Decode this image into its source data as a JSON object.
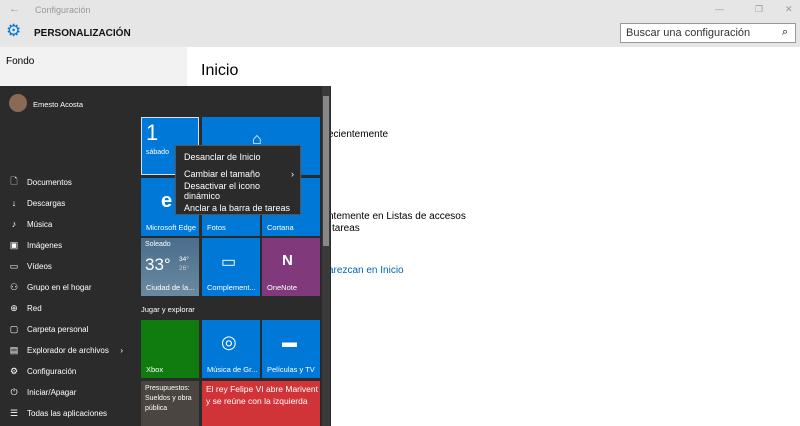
{
  "window": {
    "title": "Configuración",
    "back_icon": "←",
    "min": "—",
    "max": "❐",
    "close": "✕"
  },
  "header": {
    "title": "PERSONALIZACIÓN",
    "search_placeholder": "Buscar una configuración"
  },
  "sidebar": {
    "items": [
      "Fondo"
    ]
  },
  "content": {
    "title": "Inicio",
    "line1": "ecientemente",
    "line2": "ntemente en Listas de accesos",
    "line3": "tareas",
    "link": "arezcan en Inicio"
  },
  "start": {
    "user": "Emesto Acosta",
    "nav": [
      {
        "label": "Documentos",
        "icon": "🗋"
      },
      {
        "label": "Descargas",
        "icon": "↓"
      },
      {
        "label": "Música",
        "icon": "♪"
      },
      {
        "label": "Imágenes",
        "icon": "▣"
      },
      {
        "label": "Vídeos",
        "icon": "▭"
      },
      {
        "label": "Grupo en el hogar",
        "icon": "⚇"
      },
      {
        "label": "Red",
        "icon": "⊕"
      },
      {
        "label": "Carpeta personal",
        "icon": "▢"
      },
      {
        "label": "Explorador de archivos",
        "icon": "▤",
        "arrow": "›"
      },
      {
        "label": "Configuración",
        "icon": "⚙"
      },
      {
        "label": "Iniciar/Apagar",
        "icon": "⏻"
      },
      {
        "label": "Todas las aplicaciones",
        "icon": "☰"
      }
    ],
    "tiles": {
      "calendar": {
        "day": "1",
        "weekday": "sábado"
      },
      "edge": "Microsoft Edge",
      "photos": "Fotos",
      "cortana": "Cortana",
      "weather": {
        "cond": "Soleado",
        "temp": "33°",
        "high": "34°",
        "low": "26°",
        "city": "Ciudad de la..."
      },
      "companion": "Complement...",
      "onenote": "OneNote",
      "group": "Jugar y explorar",
      "xbox": "Xbox",
      "groove": "Música de Gr...",
      "movies": "Películas y TV",
      "news1": "Presupuestos: Sueldos y obra pública",
      "news2": "El rey Felipe VI abre Marivent y se reúne con la izquierda"
    },
    "context_menu": [
      "Desanclar de Inicio",
      "Cambiar el tamaño",
      "Desactivar el icono dinámico",
      "Anclar a la barra de tareas"
    ],
    "submenu_arrow": "›"
  }
}
